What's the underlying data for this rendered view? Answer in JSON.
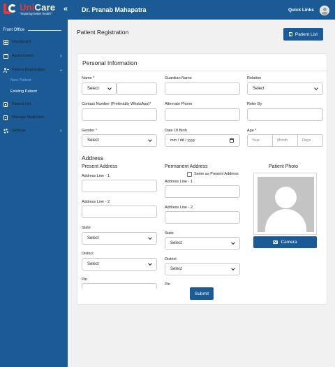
{
  "header": {
    "logo_name_accent": "Uni",
    "logo_name": "Care",
    "logo_tagline": "\"Inspiring better health\"",
    "doctor_name": "Dr. Pranab Mahapatra",
    "quick_links": "Quick Links",
    "brand_color": "#1c5a96"
  },
  "sidebar": {
    "section": "Front Office",
    "items": [
      {
        "label": "Dashboard",
        "icon": "dashboard-icon"
      },
      {
        "label": "Appointment",
        "icon": "calendar-icon"
      },
      {
        "label": "Patient Registration",
        "icon": "user-plus-icon"
      },
      {
        "label": "Patient List",
        "icon": "document-icon"
      },
      {
        "label": "Manage Medicines",
        "icon": "document-icon"
      },
      {
        "label": "Settings",
        "icon": "gear-icon"
      }
    ],
    "subitems": [
      {
        "label": "New Patient",
        "active": true
      },
      {
        "label": "Existing Patient",
        "active": false
      }
    ]
  },
  "main": {
    "page_title": "Patient Registration",
    "patient_list_button": "Patient List"
  },
  "form": {
    "section_title": "Personal Information",
    "name_label": "Name *",
    "name_prefix_value": "Select",
    "guardian_label": "Guardian Name",
    "relation_label": "Relation",
    "relation_value": "Select",
    "contact_label": "Contact Number (Preferably WhatsApp)*",
    "alt_phone_label": "Alternate Phone",
    "refer_label": "Refer By",
    "gender_label": "Gender *",
    "gender_value": "Select",
    "dob_label": "Date Of Birth",
    "dob_placeholder": "mm / dd / yyyy",
    "age_label": "Age *",
    "age_year": "Year",
    "age_month": "Month",
    "age_days": "Days",
    "address_title": "Address",
    "present_title": "Present Address",
    "permanent_title": "Permanent Address",
    "same_as_present": "Same as Present Address",
    "addr1_label": "Address Line - 1",
    "addr2_label": "Address Line - 2",
    "state_label": "State",
    "district_label": "District",
    "pin_label": "Pin",
    "select_text": "Select",
    "photo_title": "Patient Photo",
    "camera_button": "Camera",
    "submit_button": "Submit"
  }
}
